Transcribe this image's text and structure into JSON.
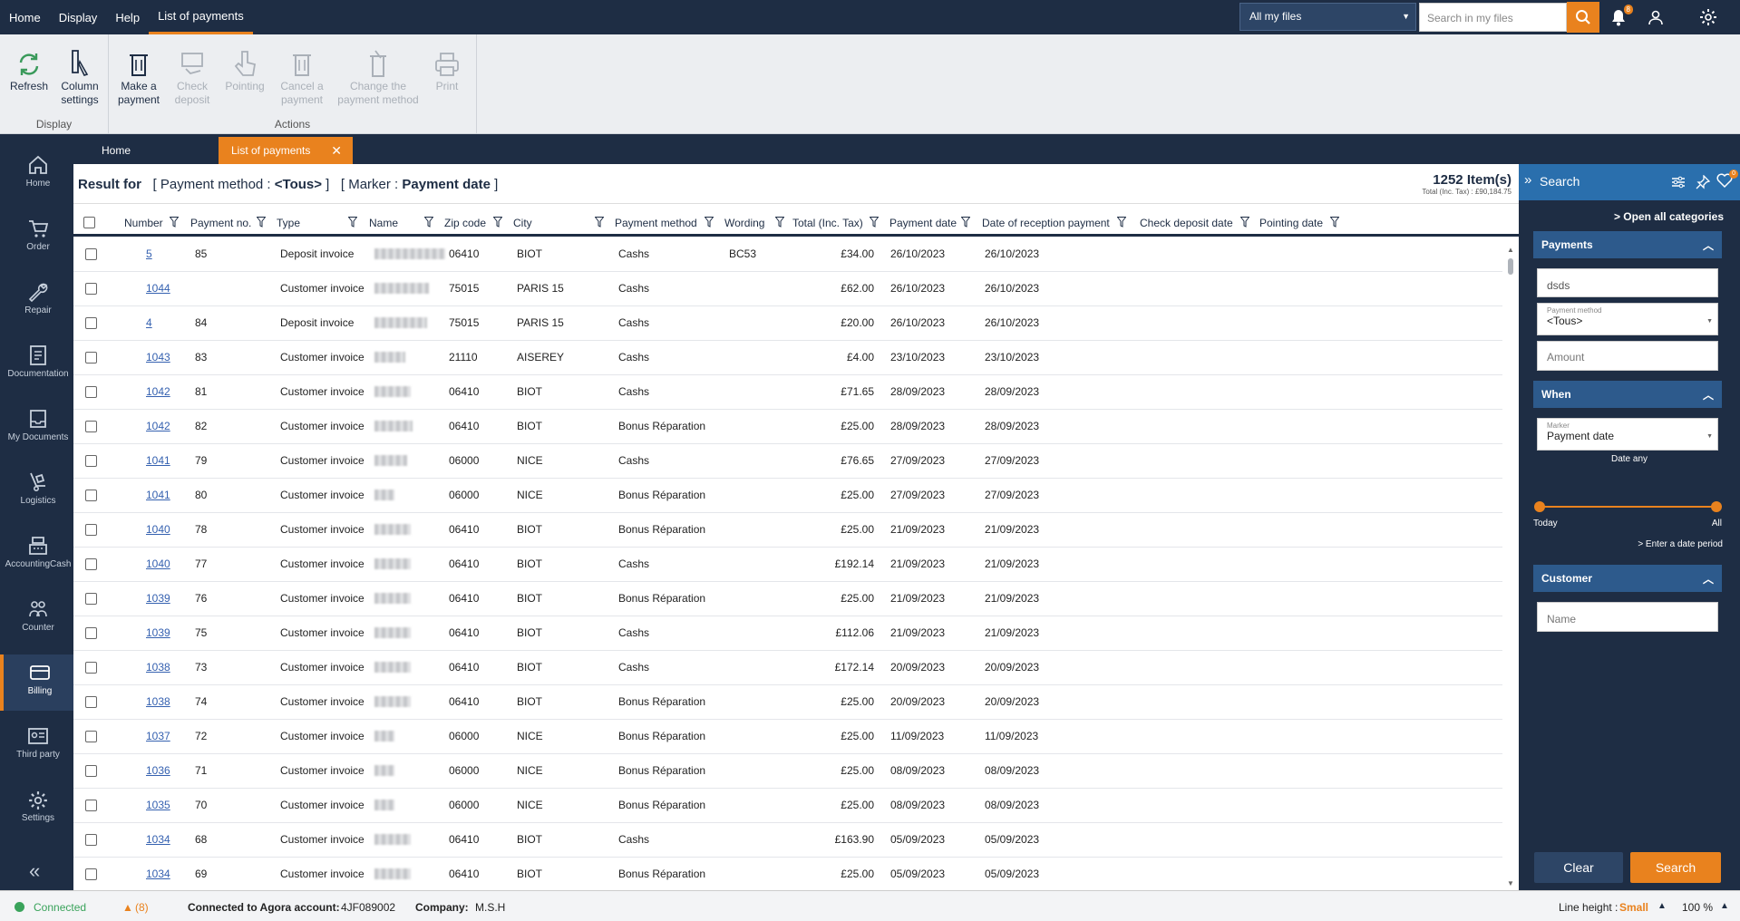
{
  "menu": [
    "Home",
    "Display",
    "Help",
    "List of payments"
  ],
  "topbar": {
    "file_filter": "All my files",
    "search_placeholder": "Search in my files",
    "notif_count": "8",
    "settings_badge": ""
  },
  "ribbon": {
    "display_group": "Display",
    "actions_group": "Actions",
    "refresh": "Refresh",
    "column_settings": "Column settings",
    "make_payment": "Make a payment",
    "check_deposit": "Check deposit",
    "pointing": "Pointing",
    "cancel_payment": "Cancel a payment",
    "change_method": "Change the payment method",
    "print": "Print"
  },
  "nav": [
    "Home",
    "Order",
    "Repair",
    "Documentation",
    "My Documents",
    "Logistics",
    "AccountingCash",
    "Counter",
    "Billing",
    "Third party",
    "Settings"
  ],
  "tabs": {
    "home": "Home",
    "list": "List of payments"
  },
  "result": {
    "prefix": "Result for",
    "filter1": "[ Payment method : ",
    "filter1_val": "<Tous>",
    "filter1_end": " ]",
    "filter2": "[ Marker : ",
    "filter2_val": "Payment date",
    "filter2_end": " ]",
    "count": "1252 Item(s)",
    "total": "Total (Inc. Tax) : £90,184.75"
  },
  "columns": [
    "Number",
    "Payment no.",
    "Type",
    "Name",
    "Zip code",
    "City",
    "Payment method",
    "Wording",
    "Total (Inc. Tax)",
    "Payment date",
    "Date of reception payment",
    "Check deposit date",
    "Pointing date"
  ],
  "rows": [
    {
      "number": "5",
      "pno": "85",
      "type": "Deposit invoice",
      "zip": "06410",
      "city": "BIOT",
      "method": "Cashs",
      "wording": "BC53",
      "total": "£34.00",
      "pdate": "26/10/2023",
      "rdate": "26/10/2023"
    },
    {
      "number": "1044",
      "pno": "",
      "type": "Customer invoice",
      "zip": "75015",
      "city": "PARIS 15",
      "method": "Cashs",
      "wording": "",
      "total": "£62.00",
      "pdate": "26/10/2023",
      "rdate": "26/10/2023"
    },
    {
      "number": "4",
      "pno": "84",
      "type": "Deposit invoice",
      "zip": "75015",
      "city": "PARIS 15",
      "method": "Cashs",
      "wording": "",
      "total": "£20.00",
      "pdate": "26/10/2023",
      "rdate": "26/10/2023"
    },
    {
      "number": "1043",
      "pno": "83",
      "type": "Customer invoice",
      "zip": "21110",
      "city": "AISEREY",
      "method": "Cashs",
      "wording": "",
      "total": "£4.00",
      "pdate": "23/10/2023",
      "rdate": "23/10/2023"
    },
    {
      "number": "1042",
      "pno": "81",
      "type": "Customer invoice",
      "zip": "06410",
      "city": "BIOT",
      "method": "Cashs",
      "wording": "",
      "total": "£71.65",
      "pdate": "28/09/2023",
      "rdate": "28/09/2023"
    },
    {
      "number": "1042",
      "pno": "82",
      "type": "Customer invoice",
      "zip": "06410",
      "city": "BIOT",
      "method": "Bonus Réparation",
      "wording": "",
      "total": "£25.00",
      "pdate": "28/09/2023",
      "rdate": "28/09/2023"
    },
    {
      "number": "1041",
      "pno": "79",
      "type": "Customer invoice",
      "zip": "06000",
      "city": "NICE",
      "method": "Cashs",
      "wording": "",
      "total": "£76.65",
      "pdate": "27/09/2023",
      "rdate": "27/09/2023"
    },
    {
      "number": "1041",
      "pno": "80",
      "type": "Customer invoice",
      "zip": "06000",
      "city": "NICE",
      "method": "Bonus Réparation",
      "wording": "",
      "total": "£25.00",
      "pdate": "27/09/2023",
      "rdate": "27/09/2023"
    },
    {
      "number": "1040",
      "pno": "78",
      "type": "Customer invoice",
      "zip": "06410",
      "city": "BIOT",
      "method": "Bonus Réparation",
      "wording": "",
      "total": "£25.00",
      "pdate": "21/09/2023",
      "rdate": "21/09/2023"
    },
    {
      "number": "1040",
      "pno": "77",
      "type": "Customer invoice",
      "zip": "06410",
      "city": "BIOT",
      "method": "Cashs",
      "wording": "",
      "total": "£192.14",
      "pdate": "21/09/2023",
      "rdate": "21/09/2023"
    },
    {
      "number": "1039",
      "pno": "76",
      "type": "Customer invoice",
      "zip": "06410",
      "city": "BIOT",
      "method": "Bonus Réparation",
      "wording": "",
      "total": "£25.00",
      "pdate": "21/09/2023",
      "rdate": "21/09/2023"
    },
    {
      "number": "1039",
      "pno": "75",
      "type": "Customer invoice",
      "zip": "06410",
      "city": "BIOT",
      "method": "Cashs",
      "wording": "",
      "total": "£112.06",
      "pdate": "21/09/2023",
      "rdate": "21/09/2023"
    },
    {
      "number": "1038",
      "pno": "73",
      "type": "Customer invoice",
      "zip": "06410",
      "city": "BIOT",
      "method": "Cashs",
      "wording": "",
      "total": "£172.14",
      "pdate": "20/09/2023",
      "rdate": "20/09/2023"
    },
    {
      "number": "1038",
      "pno": "74",
      "type": "Customer invoice",
      "zip": "06410",
      "city": "BIOT",
      "method": "Bonus Réparation",
      "wording": "",
      "total": "£25.00",
      "pdate": "20/09/2023",
      "rdate": "20/09/2023"
    },
    {
      "number": "1037",
      "pno": "72",
      "type": "Customer invoice",
      "zip": "06000",
      "city": "NICE",
      "method": "Bonus Réparation",
      "wording": "",
      "total": "£25.00",
      "pdate": "11/09/2023",
      "rdate": "11/09/2023"
    },
    {
      "number": "1036",
      "pno": "71",
      "type": "Customer invoice",
      "zip": "06000",
      "city": "NICE",
      "method": "Bonus Réparation",
      "wording": "",
      "total": "£25.00",
      "pdate": "08/09/2023",
      "rdate": "08/09/2023"
    },
    {
      "number": "1035",
      "pno": "70",
      "type": "Customer invoice",
      "zip": "06000",
      "city": "NICE",
      "method": "Bonus Réparation",
      "wording": "",
      "total": "£25.00",
      "pdate": "08/09/2023",
      "rdate": "08/09/2023"
    },
    {
      "number": "1034",
      "pno": "68",
      "type": "Customer invoice",
      "zip": "06410",
      "city": "BIOT",
      "method": "Cashs",
      "wording": "",
      "total": "£163.90",
      "pdate": "05/09/2023",
      "rdate": "05/09/2023"
    },
    {
      "number": "1034",
      "pno": "69",
      "type": "Customer invoice",
      "zip": "06410",
      "city": "BIOT",
      "method": "Bonus Réparation",
      "wording": "",
      "total": "£25.00",
      "pdate": "05/09/2023",
      "rdate": "05/09/2023"
    }
  ],
  "search_panel": {
    "title": "Search",
    "open_all": "Open all categories",
    "payments": "Payments",
    "wording_value": "dsds",
    "method_label": "Payment method",
    "method_value": "<Tous>",
    "amount_placeholder": "Amount",
    "when": "When",
    "marker_label": "Marker",
    "marker_value": "Payment date",
    "date_any": "Date any",
    "today": "Today",
    "all": "All",
    "enter_period": "> Enter a date period",
    "customer": "Customer",
    "name_placeholder": "Name",
    "clear": "Clear",
    "search": "Search",
    "fav_badge": "0"
  },
  "status": {
    "connected": "Connected",
    "warnings": "(8)",
    "account_label": "Connected to Agora account:",
    "account_value": "4JF089002",
    "company_label": "Company:",
    "company_value": "M.S.H",
    "line_height_label": "Line height :",
    "line_height_value": "Small",
    "zoom": "100 %"
  },
  "colors": {
    "navy": "#1e2d44",
    "accent": "#e9821e",
    "link": "#3561b0",
    "panel_blue": "#2a6fad"
  }
}
